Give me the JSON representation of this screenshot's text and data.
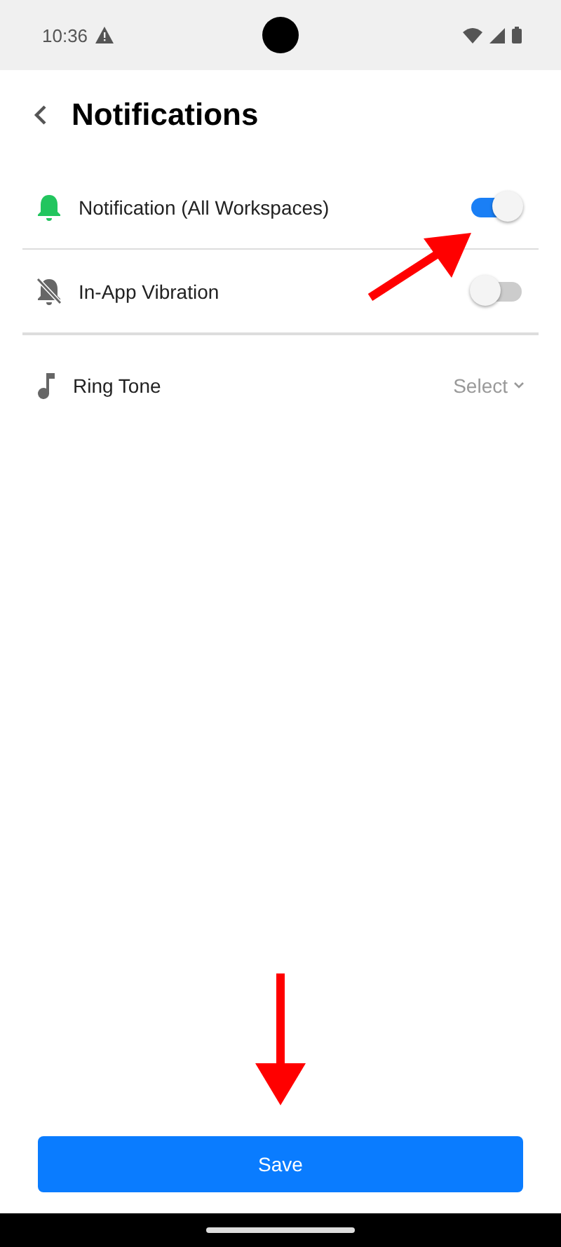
{
  "status_bar": {
    "time": "10:36"
  },
  "header": {
    "title": "Notifications"
  },
  "settings": [
    {
      "kind": "toggle",
      "label": "Notification (All Workspaces)",
      "on": true
    },
    {
      "kind": "toggle",
      "label": "In-App Vibration",
      "on": false
    },
    {
      "kind": "select",
      "label": "Ring Tone",
      "value": "Select"
    }
  ],
  "save_button": {
    "label": "Save"
  }
}
